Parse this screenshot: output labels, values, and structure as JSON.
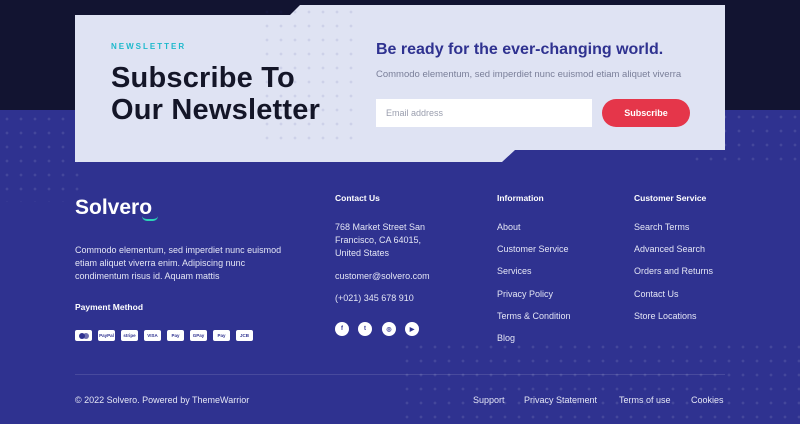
{
  "newsletter": {
    "eyebrow": "NEWSLETTER",
    "title_line1": "Subscribe To",
    "title_line2": "Our Newsletter",
    "headline": "Be ready for the ever-changing world.",
    "subline": "Commodo elementum, sed imperdiet nunc euismod etiam aliquet viverra",
    "email_placeholder": "Email address",
    "subscribe_label": "Subscribe"
  },
  "brand": {
    "logo": "Solvero",
    "about": "Commodo elementum, sed imperdiet nunc euismod etiam aliquet viverra enim. Adipiscing nunc condimentum risus id. Aquam mattis",
    "payment_title": "Payment Method",
    "payments": [
      "mastercard",
      "PayPal",
      "stripe",
      "VISA",
      "Pay",
      "GPay",
      "Pay",
      "JCB"
    ]
  },
  "contact": {
    "title": "Contact Us",
    "address": "768 Market Street San Francisco, CA 64015, United States",
    "email": "customer@solvero.com",
    "phone": "(+021) 345 678 910",
    "socials": [
      "facebook-icon",
      "twitter-icon",
      "instagram-icon",
      "youtube-icon"
    ]
  },
  "information": {
    "title": "Information",
    "links": [
      "About",
      "Customer Service",
      "Services",
      "Privacy Policy",
      "Terms & Condition",
      "Blog"
    ]
  },
  "customer_service": {
    "title": "Customer Service",
    "links": [
      "Search Terms",
      "Advanced Search",
      "Orders and Returns",
      "Contact Us",
      "Store Locations"
    ]
  },
  "bottom": {
    "copyright": "© 2022 Solvero. Powered by ThemeWarrior",
    "links": [
      "Support",
      "Privacy Statement",
      "Terms of use",
      "Cookies"
    ]
  },
  "colors": {
    "footer_bg": "#2f3290",
    "top_dark": "#121431",
    "card_bg": "#dfe3f3",
    "accent_red": "#e5364a",
    "accent_teal": "#1fb9cc"
  }
}
